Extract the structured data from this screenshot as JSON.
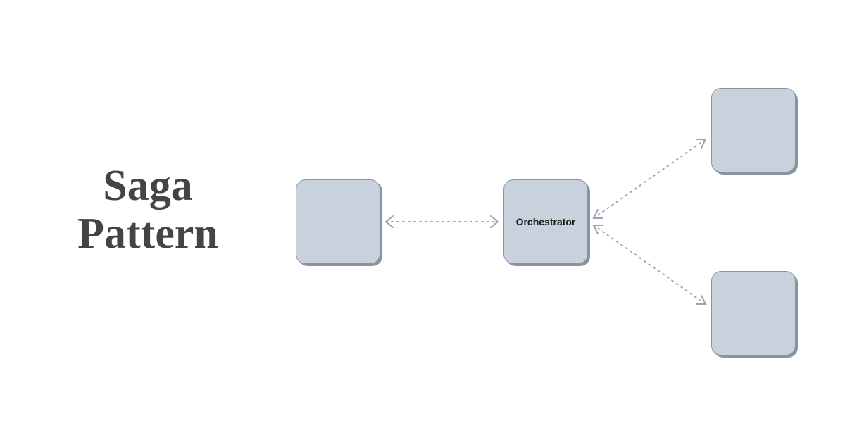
{
  "title": {
    "line1": "Saga",
    "line2": "Pattern"
  },
  "nodes": {
    "left": {
      "label": ""
    },
    "orchestrator": {
      "label": "Orchestrator"
    },
    "topRight": {
      "label": ""
    },
    "bottomRight": {
      "label": ""
    }
  },
  "colors": {
    "nodeFill": "#c9d2dc",
    "nodeBorder": "#8a94a0",
    "connector": "#9aa4b0",
    "titleText": "#444444"
  }
}
